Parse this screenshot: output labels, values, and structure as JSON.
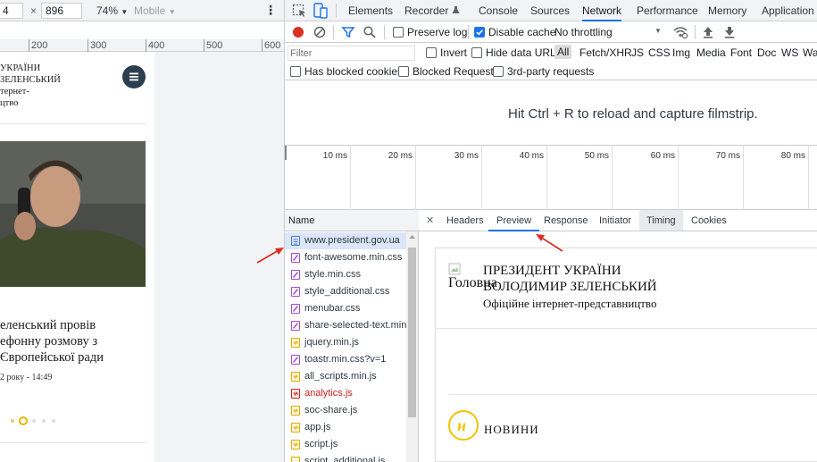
{
  "device_toolbar": {
    "width_value": "4",
    "times": "×",
    "height_value": "896",
    "zoom": "74%",
    "zoom_caret": "▼",
    "device": "Mobile",
    "device_caret": "▼",
    "more": "⋮"
  },
  "ruler": {
    "ticks": [
      "200",
      "300",
      "400",
      "500",
      "600"
    ]
  },
  "site": {
    "header_line1": "УКРАЇНИ",
    "header_line2": "ЗЕЛЕНСЬКИЙ",
    "header_line3": "тернет-",
    "header_line4": "цтво",
    "headline_line1": "еленський провів",
    "headline_line2": "ефонну розмову з",
    "headline_line3": "Європейської ради",
    "date": "2 року - 14:49"
  },
  "devtools": {
    "tabs": [
      "Elements",
      "Recorder",
      "Console",
      "Sources",
      "Network",
      "Performance",
      "Memory",
      "Application"
    ],
    "active_tab": "Network",
    "toolbar": {
      "preserve_log": "Preserve log",
      "disable_cache": "Disable cache",
      "throttling": "No throttling",
      "throttling_caret": "▼"
    },
    "filter": {
      "placeholder": "Filter",
      "invert": "Invert",
      "hide_data_urls": "Hide data URLs",
      "types": [
        "All",
        "Fetch/XHR",
        "JS",
        "CSS",
        "Img",
        "Media",
        "Font",
        "Doc",
        "WS",
        "Was"
      ]
    },
    "filter2": {
      "blocked_cookies": "Has blocked cookies",
      "blocked_requests": "Blocked Requests",
      "third_party": "3rd-party requests"
    },
    "filmstrip_hint": "Hit Ctrl + R to reload and capture filmstrip.",
    "timeline_labels": [
      "10 ms",
      "20 ms",
      "30 ms",
      "40 ms",
      "50 ms",
      "60 ms",
      "70 ms",
      "80 ms"
    ],
    "name_header": "Name",
    "requests": [
      {
        "name": "www.president.gov.ua",
        "type": "doc",
        "color": "#4a7bd0"
      },
      {
        "name": "font-awesome.min.css",
        "type": "css",
        "color": "#a34ad1"
      },
      {
        "name": "style.min.css",
        "type": "css",
        "color": "#a34ad1"
      },
      {
        "name": "style_additional.css",
        "type": "css",
        "color": "#a34ad1"
      },
      {
        "name": "menubar.css",
        "type": "css",
        "color": "#a34ad1"
      },
      {
        "name": "share-selected-text.min.",
        "type": "css",
        "color": "#a34ad1"
      },
      {
        "name": "jquery.min.js",
        "type": "js",
        "color": "#e0a800"
      },
      {
        "name": "toastr.min.css?v=1",
        "type": "css",
        "color": "#a34ad1"
      },
      {
        "name": "all_scripts.min.js",
        "type": "js",
        "color": "#e0a800"
      },
      {
        "name": "analytics.js",
        "type": "js-error",
        "color": "#c5221f"
      },
      {
        "name": "soc-share.js",
        "type": "js",
        "color": "#e0a800"
      },
      {
        "name": "app.js",
        "type": "js",
        "color": "#e0a800"
      },
      {
        "name": "script.js",
        "type": "js",
        "color": "#e0a800"
      },
      {
        "name": "script_additional.js",
        "type": "js",
        "color": "#e0a800"
      }
    ],
    "detail_tabs": [
      "Headers",
      "Preview",
      "Response",
      "Initiator",
      "Timing",
      "Cookies"
    ],
    "active_detail_tab": "Preview",
    "close": "✕",
    "preview": {
      "alt_text": "Головна",
      "title_line1": "ПРЕЗИДЕНТ УКРАЇНИ",
      "title_line2": "ВОЛОДИМИР ЗЕЛЕНСЬКИЙ",
      "subtitle": "Офіційне інтернет-представництво",
      "news_label": "НОВИНИ",
      "news_icon_letter": "н"
    }
  },
  "colors": {
    "accent": "#1a73e8",
    "record": "#d93025",
    "arrow": "#d93025",
    "news_icon": "#f2c200"
  }
}
